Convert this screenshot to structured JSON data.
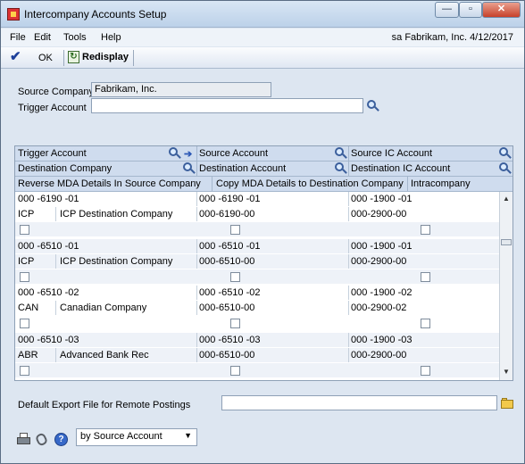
{
  "window": {
    "title": "Intercompany Accounts Setup",
    "min_glyph": "—",
    "max_glyph": "▫",
    "close_glyph": "✕"
  },
  "menu": {
    "items": [
      "File",
      "Edit",
      "Tools",
      "Help"
    ],
    "user": "sa",
    "company": "Fabrikam, Inc.",
    "date": "4/12/2017"
  },
  "toolbar": {
    "ok_label": "OK",
    "redisplay_label": "Redisplay"
  },
  "form": {
    "source_company_label": "Source Company:",
    "source_company_value": "Fabrikam, Inc.",
    "trigger_account_label": "Trigger Account",
    "trigger_account_value": ""
  },
  "grid": {
    "headers": {
      "trigger_account": "Trigger Account",
      "source_account": "Source Account",
      "source_ic_account": "Source IC Account",
      "destination_company": "Destination Company",
      "destination_account": "Destination Account",
      "destination_ic_account": "Destination IC Account",
      "reverse_mda": "Reverse MDA Details In Source Company",
      "copy_mda": "Copy MDA Details to Destination Company",
      "intracompany": "Intracompany"
    },
    "rows": [
      {
        "trigger": "000 -6190 -01",
        "source": "000 -6190 -01",
        "source_ic": "000 -1900 -01",
        "dest_code": "ICP",
        "dest_name": "ICP Destination Company",
        "dest_account": "000-6190-00",
        "dest_ic": "000-2900-00"
      },
      {
        "trigger": "000 -6510 -01",
        "source": "000 -6510 -01",
        "source_ic": "000 -1900 -01",
        "dest_code": "ICP",
        "dest_name": "ICP Destination Company",
        "dest_account": "000-6510-00",
        "dest_ic": "000-2900-00"
      },
      {
        "trigger": "000 -6510 -02",
        "source": "000 -6510 -02",
        "source_ic": "000 -1900 -02",
        "dest_code": "CAN",
        "dest_name": "Canadian Company",
        "dest_account": "000-6510-00",
        "dest_ic": "000-2900-02"
      },
      {
        "trigger": "000 -6510 -03",
        "source": "000 -6510 -03",
        "source_ic": "000 -1900 -03",
        "dest_code": "ABR",
        "dest_name": "Advanced Bank Rec",
        "dest_account": "000-6510-00",
        "dest_ic": "000-2900-00"
      }
    ]
  },
  "footer": {
    "export_label": "Default Export File for Remote Postings",
    "export_value": "",
    "sort_value": "by Source Account",
    "help_glyph": "?"
  }
}
